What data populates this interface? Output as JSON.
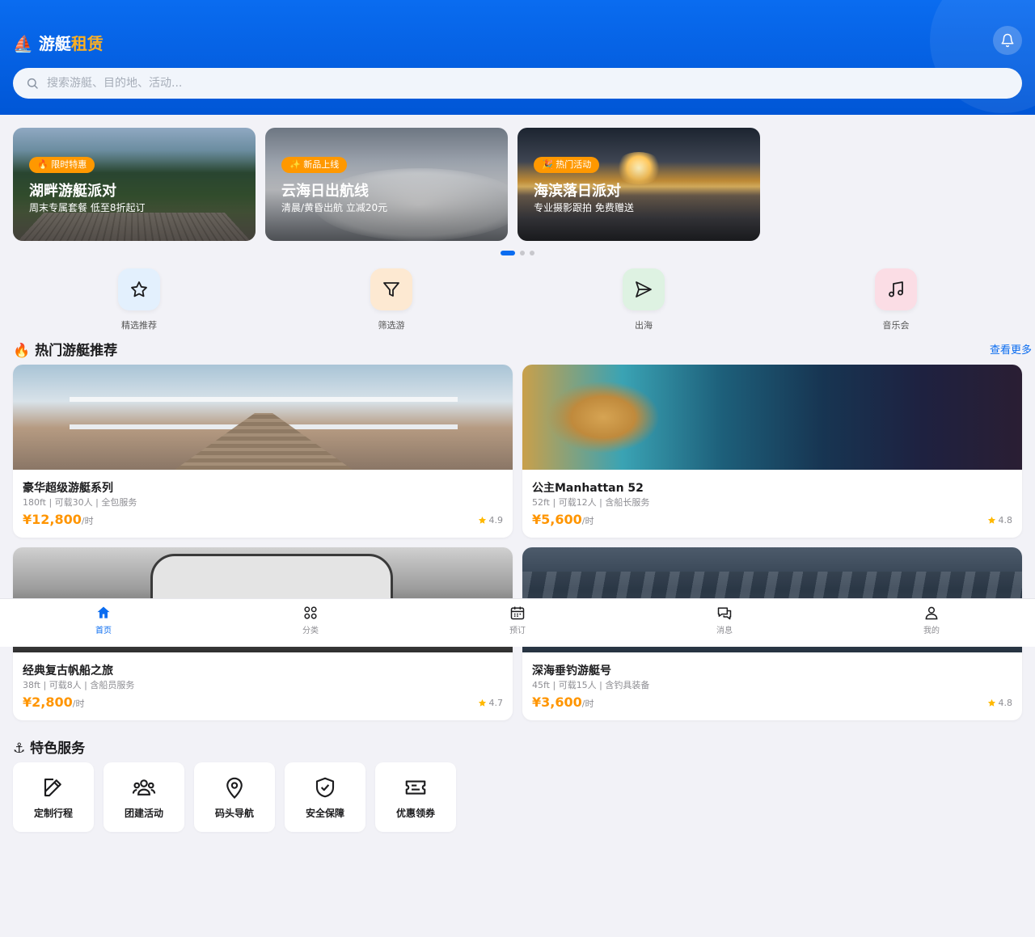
{
  "header": {
    "logo_prefix": "⛵ 游艇",
    "logo_accent": "租赁",
    "accent_color": "#ffb020",
    "brand_color": "#0a6cf0"
  },
  "search": {
    "placeholder": "搜索游艇、目的地、活动..."
  },
  "banners": [
    {
      "tag": "🔥 限时特惠",
      "title": "湖畔游艇派对",
      "subtitle": "周末专属套餐 低至8折起订"
    },
    {
      "tag": "✨ 新品上线",
      "title": "云海日出航线",
      "subtitle": "清晨/黄昏出航 立减20元"
    },
    {
      "tag": "🎉 热门活动",
      "title": "海滨落日派对",
      "subtitle": "专业摄影跟拍 免费赠送"
    }
  ],
  "carousel": {
    "pages": 3,
    "active": 0
  },
  "categories": [
    {
      "label": "精选推荐",
      "icon": "star-icon",
      "bg": "#e3f0fd"
    },
    {
      "label": "筛选游",
      "icon": "filter-icon",
      "bg": "#fde9d2"
    },
    {
      "label": "出海",
      "icon": "send-icon",
      "bg": "#def2e2"
    },
    {
      "label": "音乐会",
      "icon": "music-icon",
      "bg": "#fbdde5"
    }
  ],
  "section_hot": {
    "title": "🔥 热门游艇推荐",
    "more": "查看更多 ›"
  },
  "yachts": [
    {
      "name": "豪华超级游艇系列",
      "spec": "180ft | 可载30人 | 全包服务",
      "price": "¥12,800",
      "unit": "/时",
      "rating": "4.9"
    },
    {
      "name": "公主Manhattan 52",
      "spec": "52ft | 可载12人 | 含船长服务",
      "price": "¥5,600",
      "unit": "/时",
      "rating": "4.8"
    },
    {
      "name": "经典复古帆船之旅",
      "spec": "38ft | 可载8人 | 含船员服务",
      "price": "¥2,800",
      "unit": "/时",
      "rating": "4.7"
    },
    {
      "name": "深海垂钓游艇号",
      "spec": "45ft | 可载15人 | 含钓具装备",
      "price": "¥3,600",
      "unit": "/时",
      "rating": "4.8"
    }
  ],
  "section_service": {
    "title": "⚓ 特色服务"
  },
  "services": [
    {
      "label": "定制行程",
      "icon": "edit-icon"
    },
    {
      "label": "团建活动",
      "icon": "users-icon"
    },
    {
      "label": "码头导航",
      "icon": "location-icon"
    },
    {
      "label": "安全保障",
      "icon": "shield-check-icon"
    },
    {
      "label": "优惠领券",
      "icon": "ticket-icon"
    }
  ],
  "tabs": [
    {
      "label": "首页",
      "icon": "home-icon",
      "active": true
    },
    {
      "label": "分类",
      "icon": "grid-icon",
      "active": false
    },
    {
      "label": "预订",
      "icon": "calendar-icon",
      "active": false
    },
    {
      "label": "消息",
      "icon": "chat-icon",
      "active": false
    },
    {
      "label": "我的",
      "icon": "user-icon",
      "active": false
    }
  ]
}
